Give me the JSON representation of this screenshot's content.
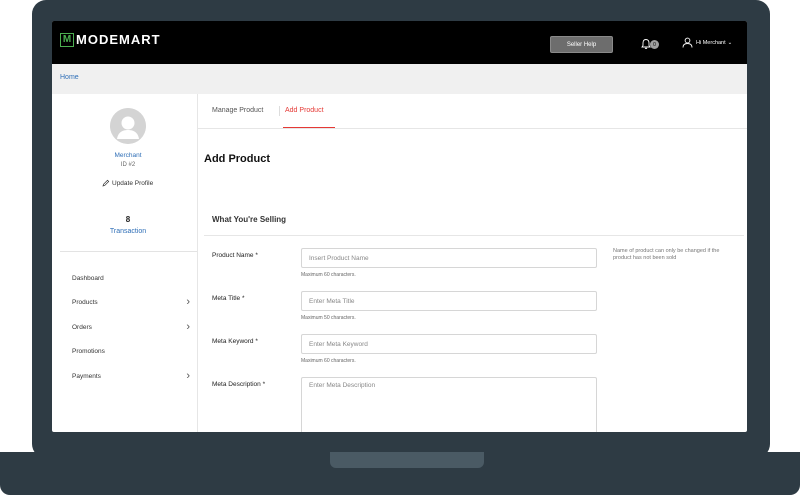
{
  "header": {
    "logo_letter": "M",
    "logo_text": "MODEMART",
    "seller_help_label": "Seller Help",
    "notification_count": "0",
    "user_greeting": "Hi Merchant"
  },
  "breadcrumb": {
    "home": "Home"
  },
  "sidebar": {
    "profile_name": "Merchant",
    "profile_id": "ID #2",
    "update_profile": "Update Profile",
    "transaction_count": "8",
    "transaction_label": "Transaction",
    "items": [
      {
        "label": "Dashboard",
        "has_submenu": false
      },
      {
        "label": "Products",
        "has_submenu": true
      },
      {
        "label": "Orders",
        "has_submenu": true
      },
      {
        "label": "Promotions",
        "has_submenu": false
      },
      {
        "label": "Payments",
        "has_submenu": true
      }
    ]
  },
  "tabs": [
    {
      "label": "Manage Product",
      "active": false
    },
    {
      "label": "Add Product",
      "active": true
    }
  ],
  "main": {
    "page_title": "Add Product",
    "section_title": "What You're Selling",
    "fields": [
      {
        "label": "Product Name *",
        "placeholder": "Insert Product Name",
        "hint": "Maximum 60 characters."
      },
      {
        "label": "Meta Title *",
        "placeholder": "Enter Meta Title",
        "hint": "Maximum 50 characters."
      },
      {
        "label": "Meta Keyword *",
        "placeholder": "Enter Meta Keyword",
        "hint": "Maximum 60 characters."
      },
      {
        "label": "Meta Description *",
        "placeholder": "Enter Meta Description"
      }
    ],
    "side_note": "Name of product can only be changed if the product has not been sold"
  },
  "colors": {
    "accent": "#e53935",
    "link": "#2f6fb7",
    "logo": "#4caf50",
    "laptop": "#2e3b44"
  }
}
